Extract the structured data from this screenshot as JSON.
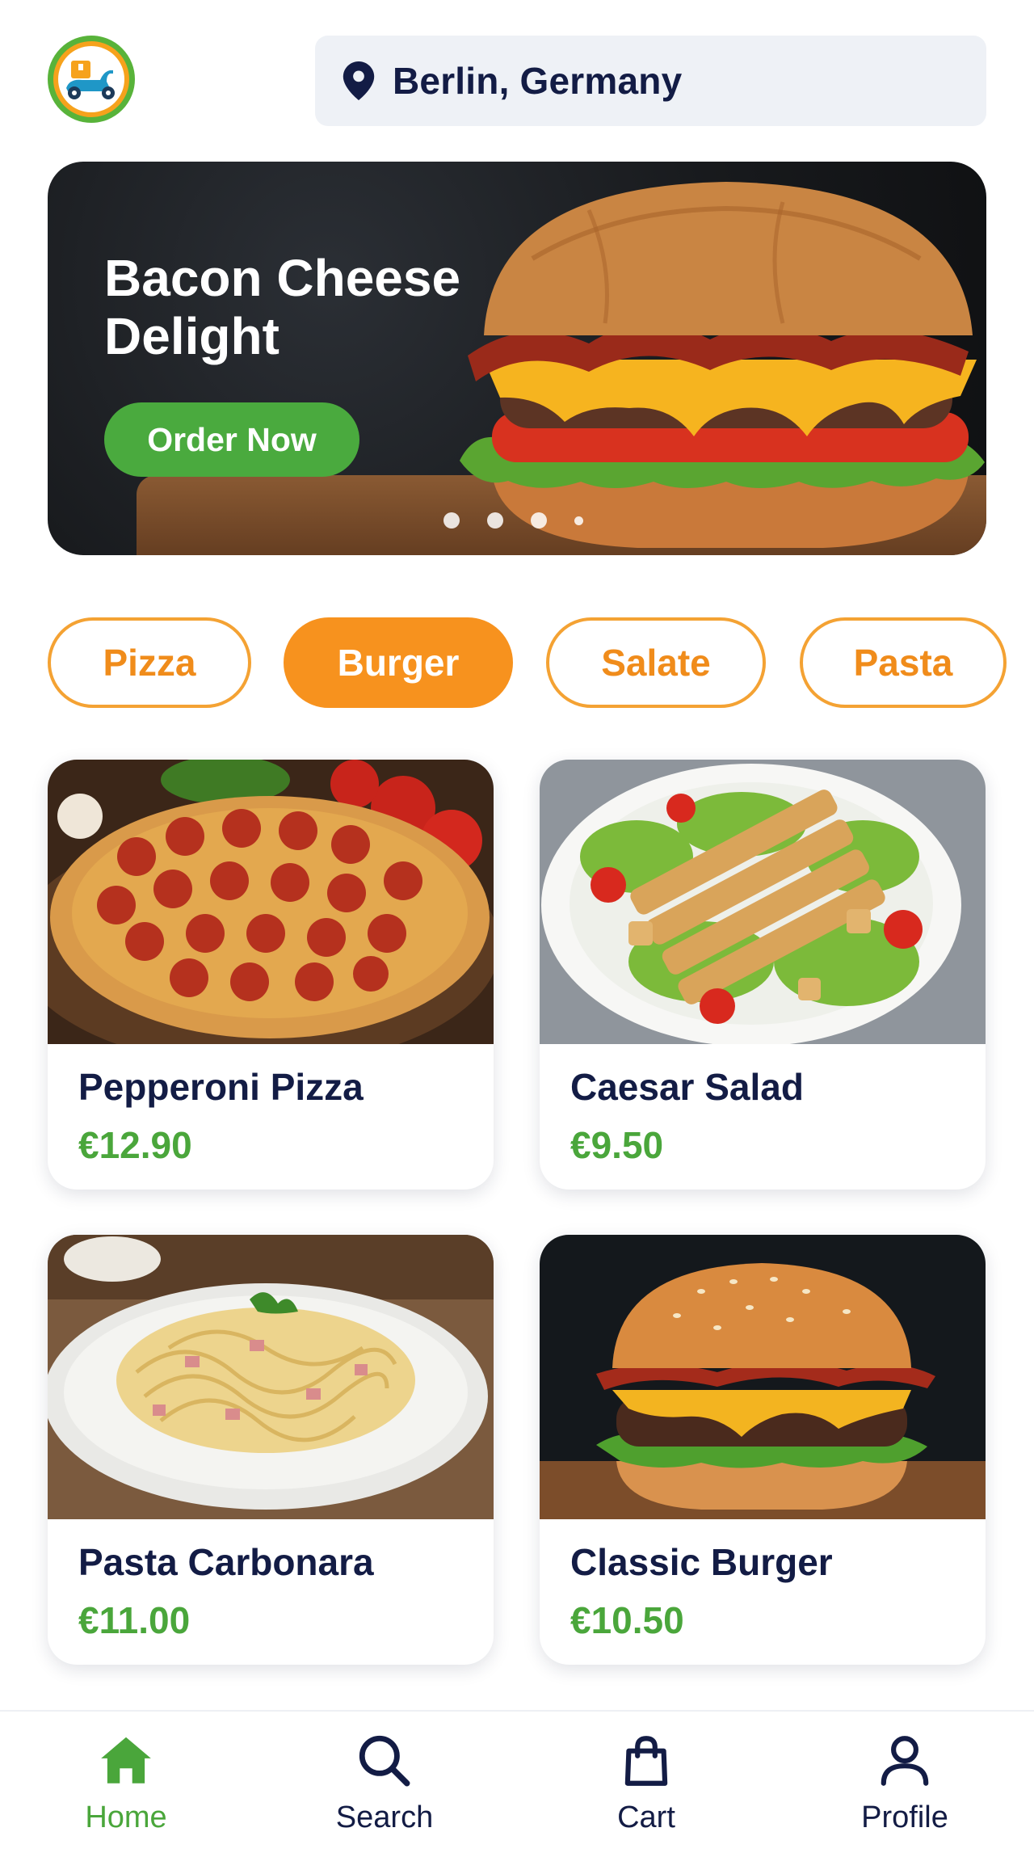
{
  "header": {
    "logo_icon": "delivery-scooter-logo",
    "location_icon": "location-pin-icon",
    "location": "Berlin, Germany"
  },
  "banner": {
    "title": "Bacon Cheese Delight",
    "button_label": "Order Now",
    "slide_count": 4,
    "active_slide": 1
  },
  "categories": [
    {
      "label": "Pizza",
      "active": false
    },
    {
      "label": "Burger",
      "active": true
    },
    {
      "label": "Salate",
      "active": false
    },
    {
      "label": "Pasta",
      "active": false
    }
  ],
  "products": [
    {
      "name": "Pepperoni Pizza",
      "price": "€12.90",
      "image": "pepperoni-pizza-photo"
    },
    {
      "name": "Caesar Salad",
      "price": "€9.50",
      "image": "caesar-salad-photo"
    },
    {
      "name": "Pasta Carbonara",
      "price": "€11.00",
      "image": "pasta-carbonara-photo"
    },
    {
      "name": "Classic Burger",
      "price": "€10.50",
      "image": "classic-burger-photo"
    }
  ],
  "nav": [
    {
      "label": "Home",
      "icon": "home-icon",
      "active": true
    },
    {
      "label": "Search",
      "icon": "search-icon",
      "active": false
    },
    {
      "label": "Cart",
      "icon": "shopping-bag-icon",
      "active": false
    },
    {
      "label": "Profile",
      "icon": "user-icon",
      "active": false
    }
  ],
  "colors": {
    "accent_orange": "#f7921e",
    "accent_green": "#4aa63b",
    "text_dark": "#131c45",
    "location_bg": "#eef1f6"
  }
}
